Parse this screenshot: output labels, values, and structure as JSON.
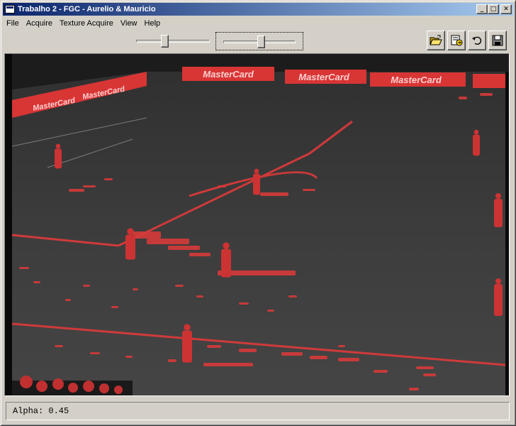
{
  "window": {
    "title": "Trabalho 2 - FGC - Aurelio & Mauricio"
  },
  "title_buttons": {
    "minimize": "_",
    "maximize": "□",
    "close": "✕"
  },
  "menu": [
    "File",
    "Acquire",
    "Texture Acquire",
    "View",
    "Help"
  ],
  "toolbar": {
    "slider1_level": 0.38,
    "slider2_level": 0.52,
    "buttons": [
      "open-icon",
      "export-icon",
      "undo-icon",
      "save-icon"
    ]
  },
  "video": {
    "billboard_text": "MasterCard",
    "overlay_color": "#ff3a3a",
    "field_color": "#3a3a3a"
  },
  "status": {
    "text": "Alpha: 0.45"
  }
}
